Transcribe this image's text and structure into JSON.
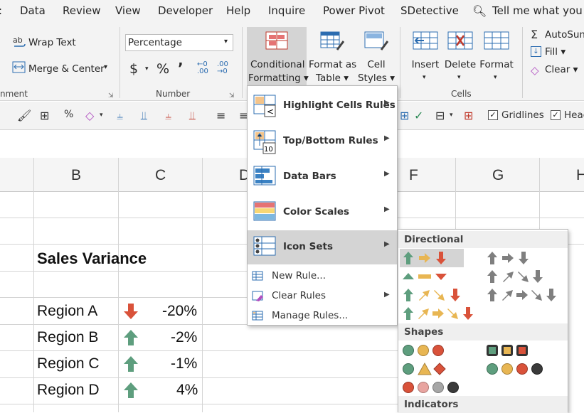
{
  "tabs": [
    "Data",
    "Review",
    "View",
    "Developer",
    "Help",
    "Inquire",
    "Power Pivot",
    "SDetective"
  ],
  "tell_me": "Tell me what you w",
  "ribbon": {
    "wrap_text": "Wrap Text",
    "merge_center": "Merge & Center",
    "alignment_group": "nment",
    "number_format": "Percentage",
    "number_group": "Number",
    "currency_symbol": "$",
    "percent_symbol": "%",
    "comma_symbol": "9",
    "inc_decimal": "←.0 .00",
    "dec_decimal": ".00 →.0",
    "conditional_formatting": [
      "Conditional",
      "Formatting ▾"
    ],
    "format_as_table": [
      "Format as",
      "Table ▾"
    ],
    "cell_styles": [
      "Cell",
      "Styles ▾"
    ],
    "insert": "Insert",
    "delete": "Delete",
    "format": "Format",
    "cells_group": "Cells",
    "autosum": "AutoSum",
    "fill": "Fill ▾",
    "clear": "Clear ▾"
  },
  "qat": {
    "gridlines": "Gridlines",
    "headings": "Head"
  },
  "columns": [
    "B",
    "C",
    "D",
    "F",
    "G",
    "H"
  ],
  "sheet": {
    "title": "Sales Variance",
    "rows": [
      {
        "region": "Region A",
        "value": "-20%",
        "arrow": "down",
        "color": "#d9523a"
      },
      {
        "region": "Region B",
        "value": "-2%",
        "arrow": "up",
        "color": "#5e9e7e"
      },
      {
        "region": "Region C",
        "value": "-1%",
        "arrow": "up",
        "color": "#5e9e7e"
      },
      {
        "region": "Region D",
        "value": "4%",
        "arrow": "up",
        "color": "#5e9e7e"
      }
    ]
  },
  "cf_menu": {
    "items": [
      "Highlight Cells Rules",
      "Top/Bottom Rules",
      "Data Bars",
      "Color Scales",
      "Icon Sets"
    ],
    "sub_items": [
      "New Rule...",
      "Clear Rules",
      "Manage Rules..."
    ]
  },
  "icon_sets": {
    "directional": "Directional",
    "shapes": "Shapes",
    "indicators": "Indicators"
  },
  "colors": {
    "green": "#5e9e7e",
    "yellow": "#e8b653",
    "red": "#d9523a",
    "gray": "#7f7f7f",
    "black": "#3a3a3a",
    "pink": "#e8a4a0",
    "lightgray": "#a6a6a6"
  }
}
